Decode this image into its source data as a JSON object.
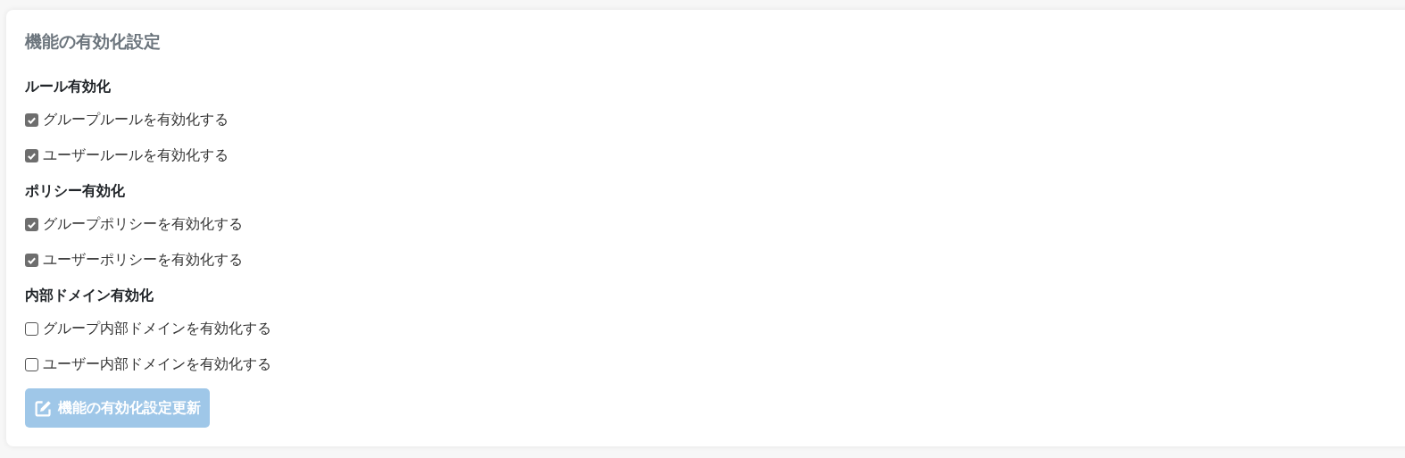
{
  "card": {
    "title": "機能の有効化設定"
  },
  "sections": [
    {
      "heading": "ルール有効化",
      "options": [
        {
          "label": "グループルールを有効化する",
          "checked": true
        },
        {
          "label": "ユーザールールを有効化する",
          "checked": true
        }
      ]
    },
    {
      "heading": "ポリシー有効化",
      "options": [
        {
          "label": "グループポリシーを有効化する",
          "checked": true
        },
        {
          "label": "ユーザーポリシーを有効化する",
          "checked": true
        }
      ]
    },
    {
      "heading": "内部ドメイン有効化",
      "options": [
        {
          "label": "グループ内部ドメインを有効化する",
          "checked": false
        },
        {
          "label": "ユーザー内部ドメインを有効化する",
          "checked": false
        }
      ]
    }
  ],
  "button": {
    "label": "機能の有効化設定更新",
    "disabled": true
  }
}
